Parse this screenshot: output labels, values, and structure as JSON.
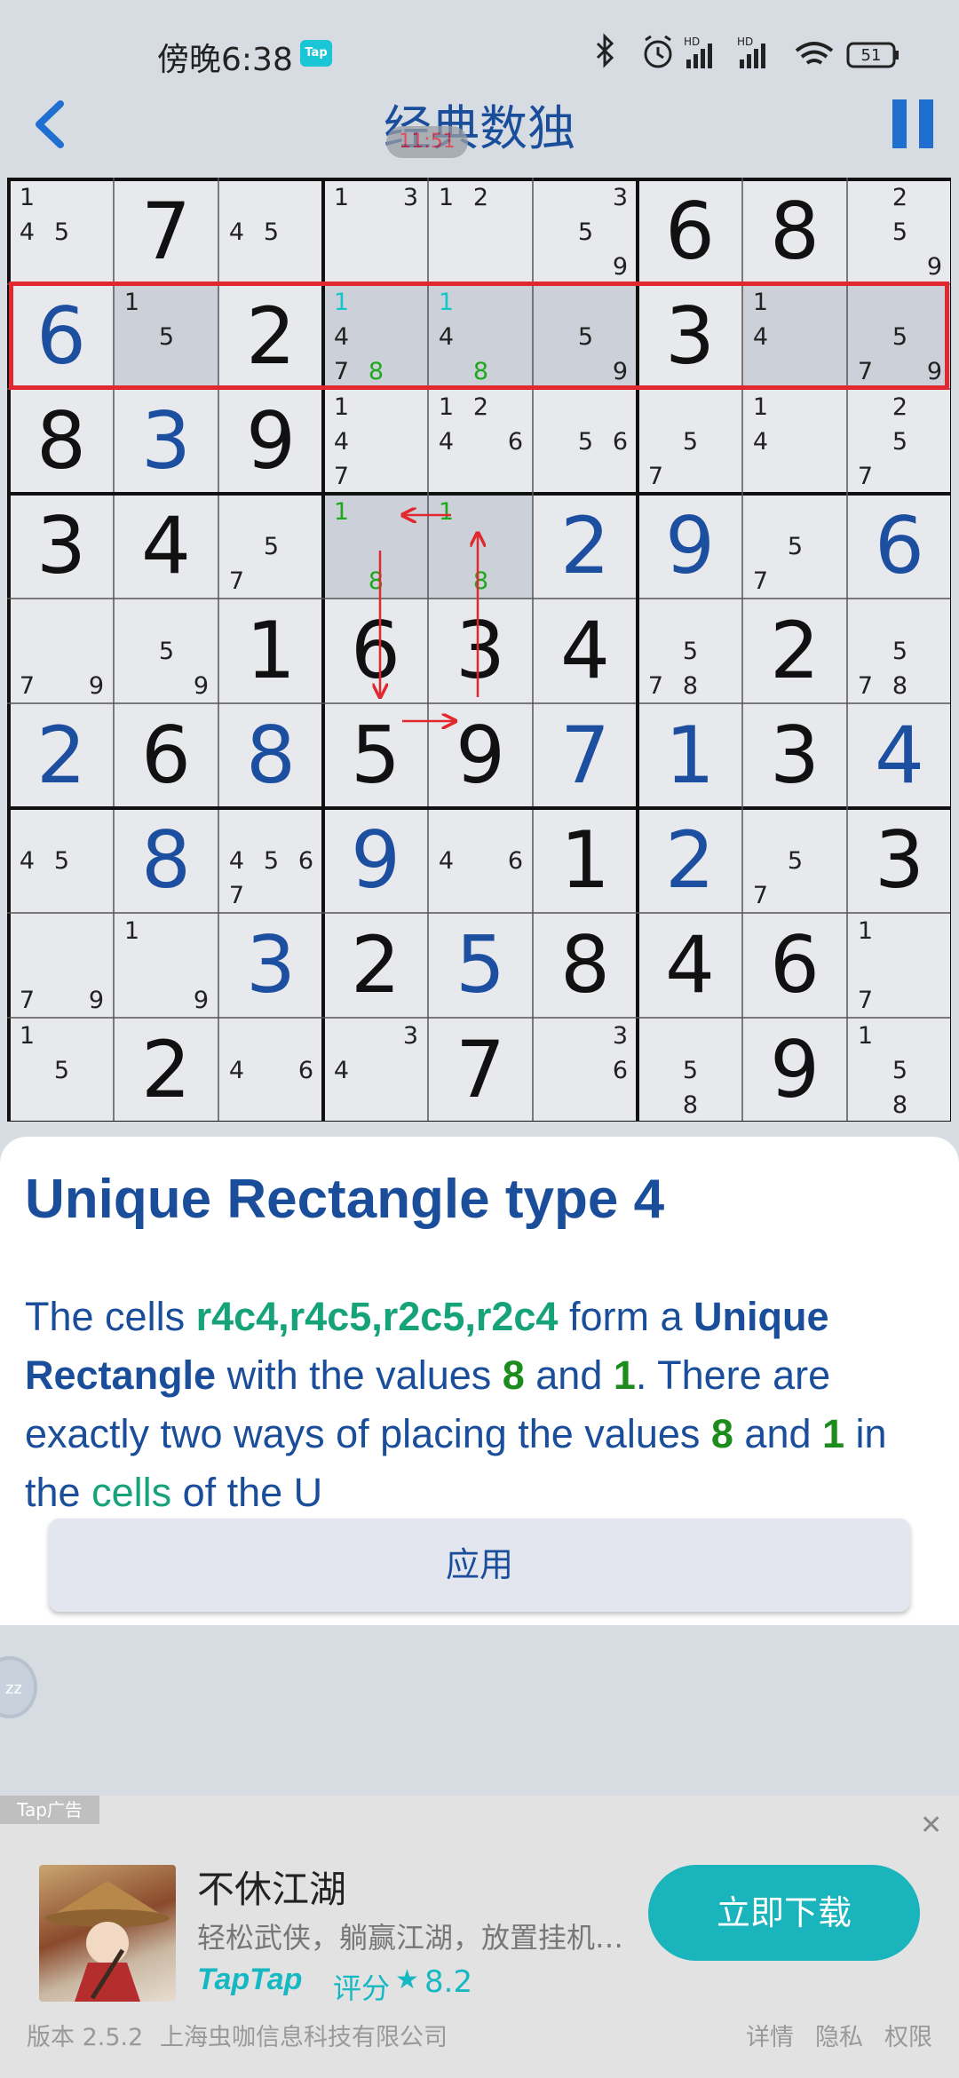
{
  "status_bar": {
    "time": "傍晚6:38",
    "tap_badge": "Tap",
    "battery": "51"
  },
  "app_bar": {
    "title": "经典数独",
    "timer": "11:51"
  },
  "board": {
    "digits": [
      [
        "",
        "7",
        "",
        "",
        "",
        "",
        "6",
        "8",
        ""
      ],
      [
        "6",
        "",
        "2",
        "",
        "",
        "",
        "3",
        "",
        ""
      ],
      [
        "8",
        "3",
        "9",
        "",
        "",
        "",
        "",
        "",
        ""
      ],
      [
        "3",
        "4",
        "",
        "",
        "",
        "2",
        "9",
        "",
        "6"
      ],
      [
        "",
        "",
        "1",
        "6",
        "3",
        "4",
        "",
        "2",
        ""
      ],
      [
        "2",
        "6",
        "8",
        "5",
        "9",
        "7",
        "1",
        "3",
        "4"
      ],
      [
        "",
        "8",
        "",
        "9",
        "",
        "1",
        "2",
        "",
        "3"
      ],
      [
        "",
        "",
        "3",
        "2",
        "5",
        "8",
        "4",
        "6",
        ""
      ],
      [
        "",
        "2",
        "",
        "",
        "7",
        "",
        "",
        "9",
        ""
      ]
    ],
    "user_filled": [
      [
        0,
        0,
        0,
        0,
        0,
        0,
        0,
        0,
        0
      ],
      [
        1,
        0,
        0,
        0,
        0,
        0,
        0,
        0,
        0
      ],
      [
        0,
        1,
        0,
        0,
        0,
        0,
        0,
        0,
        0
      ],
      [
        0,
        0,
        0,
        0,
        0,
        1,
        1,
        0,
        1
      ],
      [
        0,
        0,
        0,
        0,
        0,
        0,
        0,
        0,
        0
      ],
      [
        1,
        0,
        1,
        0,
        0,
        1,
        1,
        0,
        1
      ],
      [
        0,
        1,
        0,
        1,
        0,
        0,
        1,
        0,
        0
      ],
      [
        0,
        0,
        1,
        0,
        1,
        0,
        0,
        0,
        0
      ],
      [
        0,
        0,
        0,
        0,
        0,
        0,
        0,
        0,
        0
      ]
    ],
    "candidates": [
      [
        "145",
        "",
        "45",
        "13",
        "12",
        "359",
        "",
        "",
        "259"
      ],
      [
        "",
        "15",
        "",
        "1478",
        "148",
        "59",
        "",
        "14",
        "579"
      ],
      [
        "",
        "",
        "",
        "147",
        "1246",
        "56",
        "57",
        "14",
        "257"
      ],
      [
        "",
        "",
        "57",
        "18",
        "18",
        "",
        "",
        "57",
        ""
      ],
      [
        "79",
        "59",
        "",
        "",
        "",
        "",
        "578",
        "",
        "578"
      ],
      [
        "",
        "",
        "",
        "",
        "",
        "",
        "",
        "",
        ""
      ],
      [
        "45",
        "",
        "4567",
        "",
        "46",
        "",
        "",
        "57",
        ""
      ],
      [
        "79",
        "19",
        "",
        "",
        "",
        "",
        "",
        "",
        "17"
      ],
      [
        "15",
        "",
        "46",
        "34",
        "",
        "36",
        "58",
        "",
        "158"
      ]
    ],
    "highlight": {
      "row": 2,
      "cells": [
        "r4c4",
        "r4c5"
      ]
    },
    "candidate_colors": {
      "green": "#1fa81f",
      "cyan": "#14c6c8"
    }
  },
  "hint": {
    "title": "Unique Rectangle type 4",
    "text": {
      "t1": "The cells ",
      "cells": "r4c4,r4c5,r2c5,r2c4",
      "t2": " form a ",
      "ur": "Unique Rectangle",
      "t3": " with the values ",
      "v8": "8",
      "t4": " and ",
      "v1": "1",
      "t5": ". There are exactly two ways of placing the values ",
      "v8b": "8",
      "t6": " and ",
      "v1b": "1",
      "t7": " in the ",
      "cellsword": "cells",
      "t8": " of the U"
    },
    "apply_label": "应用"
  },
  "fab": {
    "label": "zz"
  },
  "ad": {
    "label": "Tap广告",
    "close": "✕",
    "name": "不休江湖",
    "desc": "轻松武侠，躺赢江湖，放置挂机…",
    "brand": "TapTap",
    "rating_label": "评分",
    "star": "★",
    "score": "8.2",
    "download": "立即下载"
  },
  "footer": {
    "version": "版本 2.5.2",
    "company": "上海虫咖信息科技有限公司",
    "details": "详情",
    "privacy": "隐私",
    "permissions": "权限"
  },
  "colors": {
    "accent": "#1a4d9a",
    "given": "#111111",
    "user": "#1c4fa0",
    "highlight_row": "#e0282e",
    "ad_button": "#1ab4bc"
  }
}
